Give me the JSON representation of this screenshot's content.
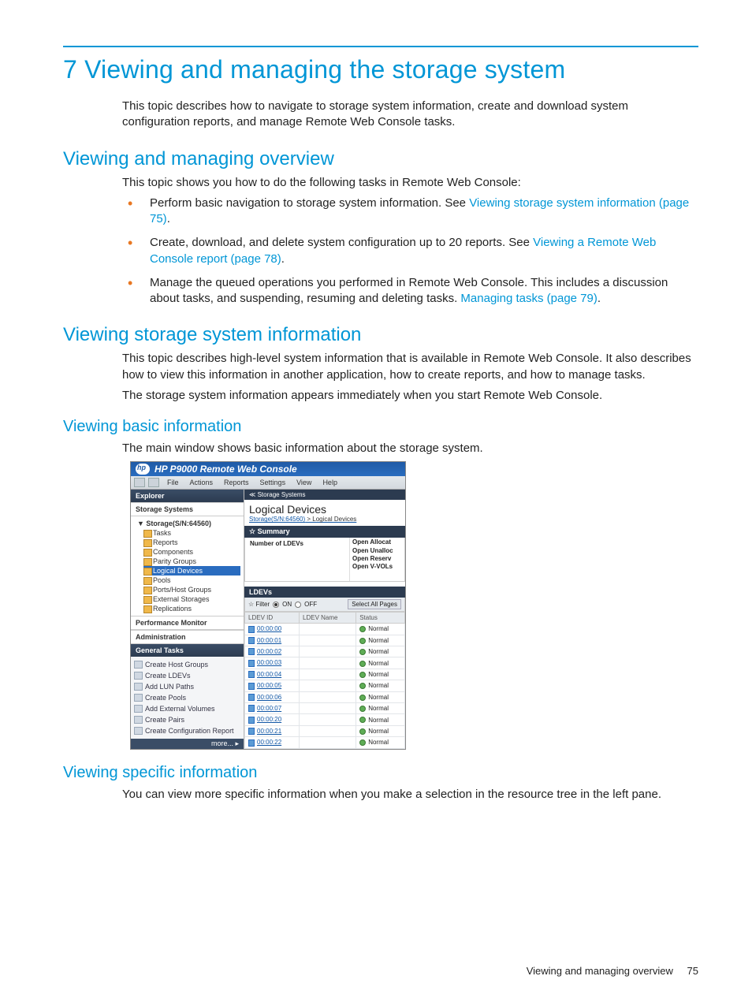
{
  "chapter_title": "7 Viewing and managing the storage system",
  "intro": "This topic describes how to navigate to storage system information, create and download system configuration reports, and manage Remote Web Console tasks.",
  "h2_overview": "Viewing and managing overview",
  "overview_intro": "This topic shows you how to do the following tasks in Remote Web Console:",
  "bullets": {
    "b1_a": "Perform basic navigation to storage system information. See ",
    "b1_link": "Viewing storage system information (page 75)",
    "b1_b": ".",
    "b2_a": "Create, download, and delete system configuration up to 20 reports. See ",
    "b2_link": "Viewing a Remote Web Console report (page 78)",
    "b2_b": ".",
    "b3_a": "Manage the queued operations you performed in Remote Web Console. This includes a discussion about tasks, and suspending, resuming and deleting tasks. ",
    "b3_link": "Managing tasks (page 79)",
    "b3_b": "."
  },
  "h2_viewinfo": "Viewing storage system information",
  "viewinfo_p1": "This topic describes high-level system information that is available in Remote Web Console. It also describes how to view this information in another application, how to create reports, and how to manage tasks.",
  "viewinfo_p2": "The storage system information appears immediately when you start Remote Web Console.",
  "h3_basic": "Viewing basic information",
  "basic_p": "The main window shows basic information about the storage system.",
  "h3_specific": "Viewing specific information",
  "specific_p": "You can view more specific information when you make a selection in the resource tree in the left pane.",
  "footer_text": "Viewing and managing overview",
  "footer_page": "75",
  "shot": {
    "title": "HP P9000 Remote Web Console",
    "menus": [
      "File",
      "Actions",
      "Reports",
      "Settings",
      "View",
      "Help"
    ],
    "left": {
      "explorer": "Explorer",
      "storage_systems": "Storage Systems",
      "root": "Storage(S/N:64560)",
      "tree": [
        "Tasks",
        "Reports",
        "Components",
        "Parity Groups",
        "Logical Devices",
        "Pools",
        "Ports/Host Groups",
        "External Storages",
        "Replications"
      ],
      "selected_index": 4,
      "perfmon": "Performance Monitor",
      "admin": "Administration",
      "general_tasks": "General Tasks",
      "tasks": [
        "Create Host Groups",
        "Create LDEVs",
        "Add LUN Paths",
        "Create Pools",
        "Add External Volumes",
        "Create Pairs",
        "Create Configuration Report"
      ],
      "more": "more... ▸"
    },
    "right": {
      "crumb_bar": "≪ Storage Systems",
      "heading": "Logical Devices",
      "breadcrumb_a": "Storage(S/N:64560)",
      "breadcrumb_sep": " > Logical Devices",
      "summary_head": "☆  Summary",
      "summary_left": "Number of LDEVs",
      "summary_right": [
        "Open Allocat",
        "Open Unalloc",
        "Open Reserv",
        "Open V-VOLs"
      ],
      "ldevs_head": "LDEVs",
      "filter_label": "☆ Filter",
      "filter_on": "ON",
      "filter_off": "OFF",
      "select_all": "Select All Pages",
      "cols": [
        "LDEV ID",
        "LDEV Name",
        "Status"
      ],
      "rows": [
        {
          "id": "00:00:00",
          "status": "Normal"
        },
        {
          "id": "00:00:01",
          "status": "Normal"
        },
        {
          "id": "00:00:02",
          "status": "Normal"
        },
        {
          "id": "00:00:03",
          "status": "Normal"
        },
        {
          "id": "00:00:04",
          "status": "Normal"
        },
        {
          "id": "00:00:05",
          "status": "Normal"
        },
        {
          "id": "00:00:06",
          "status": "Normal"
        },
        {
          "id": "00:00:07",
          "status": "Normal"
        },
        {
          "id": "00:00:20",
          "status": "Normal"
        },
        {
          "id": "00:00:21",
          "status": "Normal"
        },
        {
          "id": "00:00:22",
          "status": "Normal"
        }
      ]
    }
  }
}
